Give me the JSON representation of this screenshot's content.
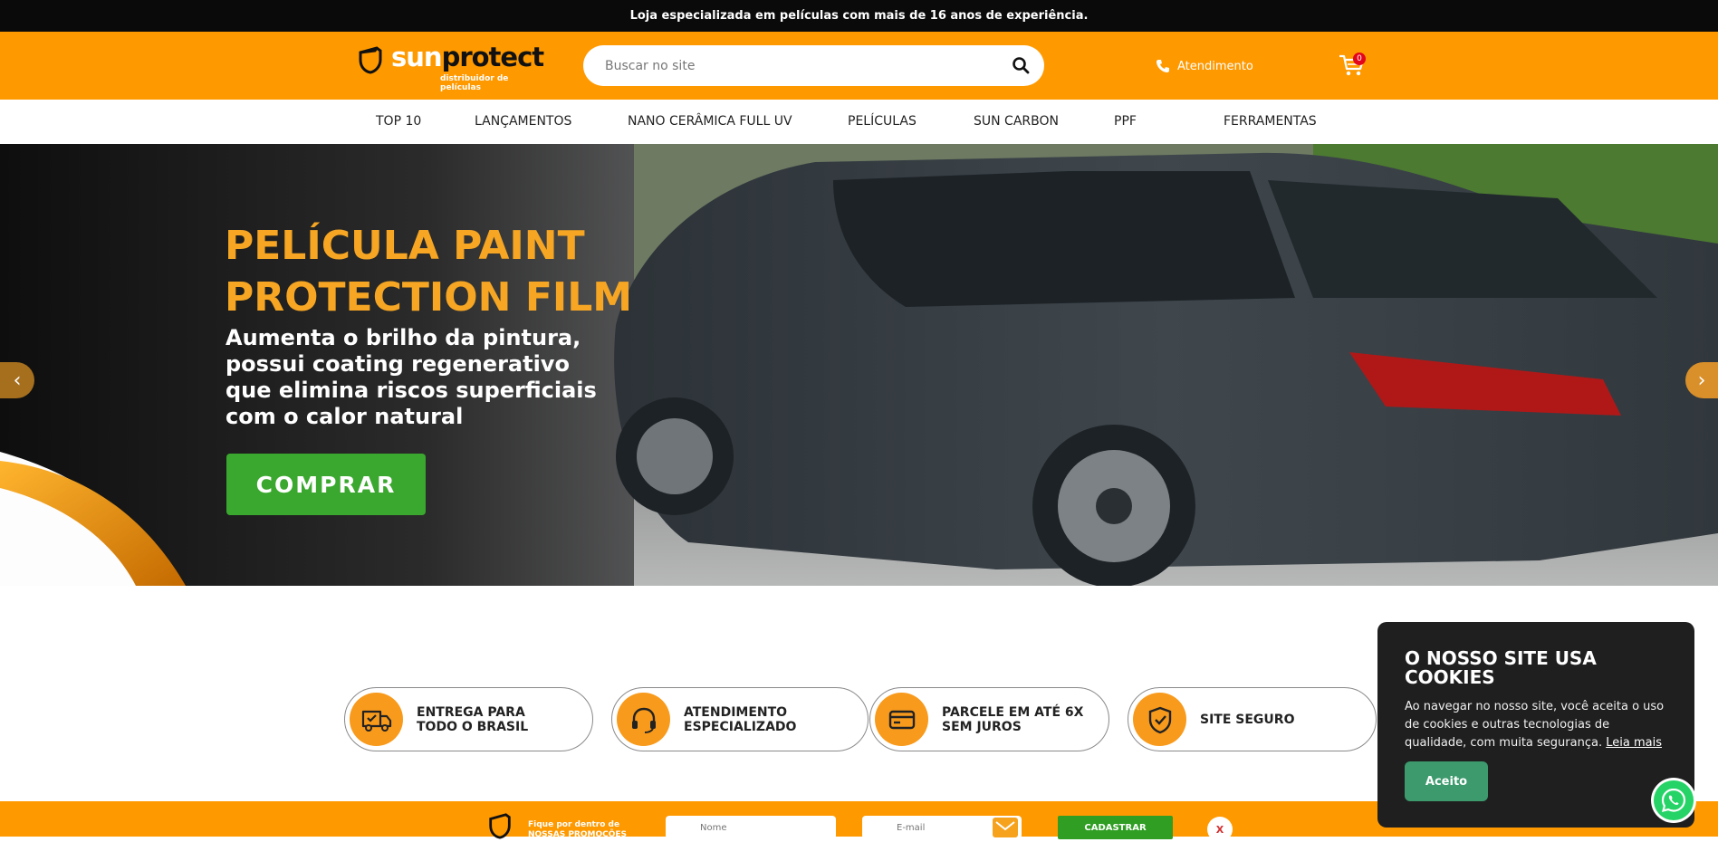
{
  "topbar": {
    "message": "Loja especializada em películas com mais de 16 anos de experiência."
  },
  "header": {
    "logo": {
      "word_sun": "sun",
      "word_protect": "protect",
      "tagline": "distribuidor de películas"
    },
    "search": {
      "placeholder": "Buscar no site",
      "value": ""
    },
    "support_label": "Atendimento",
    "cart_count": "0"
  },
  "nav": {
    "items": [
      "TOP 10",
      "LANÇAMENTOS",
      "NANO CERÂMICA FULL UV",
      "PELÍCULAS",
      "SUN CARBON",
      "PPF",
      "FERRAMENTAS"
    ]
  },
  "hero": {
    "title_line1": "PELÍCULA PAINT",
    "title_line2": "PROTECTION FILM",
    "subtitle": "Aumenta o brilho da pintura, possui coating regenerativo que elimina riscos superficiais com o calor natural",
    "cta_label": "COMPRAR",
    "prev_arrow": "‹",
    "next_arrow": "›",
    "slide_count": 6,
    "active_slide": 4,
    "colors": {
      "title": "#f6a623",
      "cta": "#3aa82e",
      "active_dot": "#f39200"
    }
  },
  "features": [
    {
      "label": "ENTREGA PARA\nTODO O BRASIL",
      "icon": "delivery-truck-icon"
    },
    {
      "label": "ATENDIMENTO\nESPECIALIZADO",
      "icon": "headset-icon"
    },
    {
      "label": "PARCELE EM ATÉ 6X\nSEM JUROS",
      "icon": "credit-card-icon"
    },
    {
      "label": "SITE SEGURO",
      "icon": "shield-check-icon"
    }
  ],
  "newsletter": {
    "text_line1": "Fique por dentro de",
    "text_line2": "NOSSAS PROMOÇÕES",
    "name_placeholder": "Nome",
    "email_placeholder": "E-mail",
    "submit_label": "CADASTRAR",
    "close_label": "X"
  },
  "cookie": {
    "title": "O NOSSO SITE USA COOKIES",
    "text": "Ao navegar no nosso site, você aceita o uso de cookies e outras tecnologias de qualidade, com muita segurança.",
    "link_label": "Leia mais",
    "accept_label": "Aceito"
  },
  "colors": {
    "brand_orange": "#ff9900",
    "topbar": "#0a0a0a",
    "whatsapp": "#25d366"
  }
}
